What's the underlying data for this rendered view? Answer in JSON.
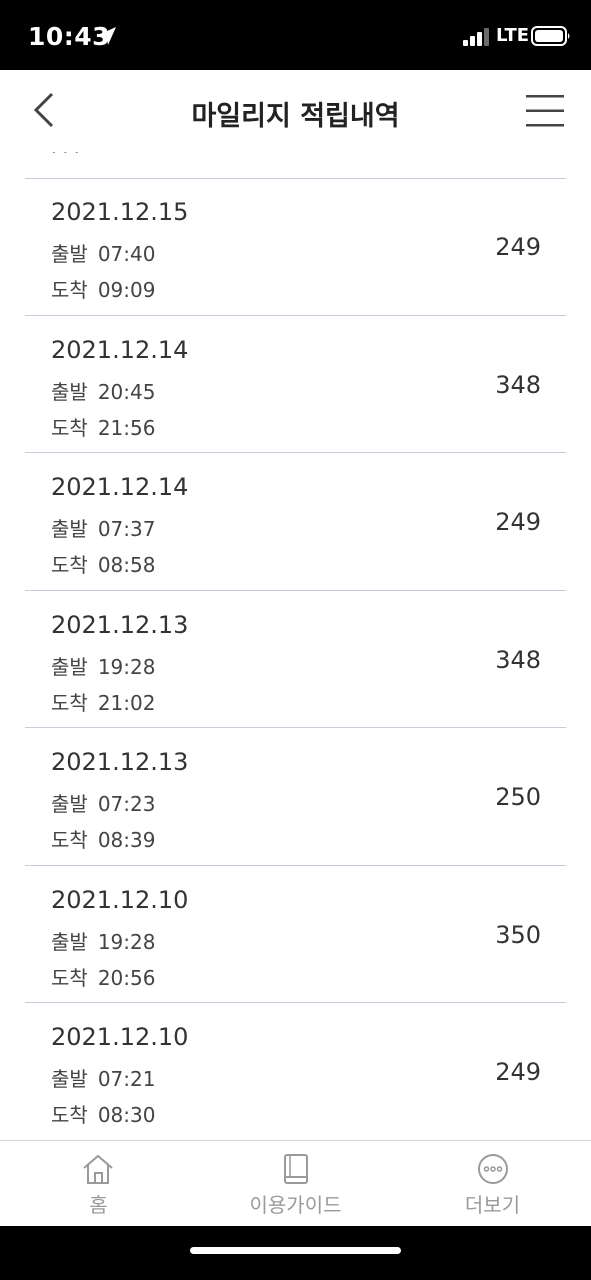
{
  "status_bar": {
    "time": "10:43",
    "network": "LTE"
  },
  "header": {
    "title": "마일리지 적립내역"
  },
  "labels": {
    "departure": "출발",
    "arrival": "도착"
  },
  "records": [
    {
      "date": "2021.12.15",
      "departure": "07:40",
      "arrival": "09:09",
      "points": "249"
    },
    {
      "date": "2021.12.14",
      "departure": "20:45",
      "arrival": "21:56",
      "points": "348"
    },
    {
      "date": "2021.12.14",
      "departure": "07:37",
      "arrival": "08:58",
      "points": "249"
    },
    {
      "date": "2021.12.13",
      "departure": "19:28",
      "arrival": "21:02",
      "points": "348"
    },
    {
      "date": "2021.12.13",
      "departure": "07:23",
      "arrival": "08:39",
      "points": "250"
    },
    {
      "date": "2021.12.10",
      "departure": "19:28",
      "arrival": "20:56",
      "points": "350"
    },
    {
      "date": "2021.12.10",
      "departure": "07:21",
      "arrival": "08:30",
      "points": "249"
    }
  ],
  "tab_bar": {
    "home": {
      "label": "홈",
      "icon": "home-icon"
    },
    "guide": {
      "label": "이용가이드",
      "icon": "book-icon"
    },
    "more": {
      "label": "더보기",
      "icon": "more-dots-icon"
    }
  },
  "colors": {
    "divider": "#c5cdd8",
    "tab_inactive": "#9a9a9a",
    "text": "#333333"
  }
}
